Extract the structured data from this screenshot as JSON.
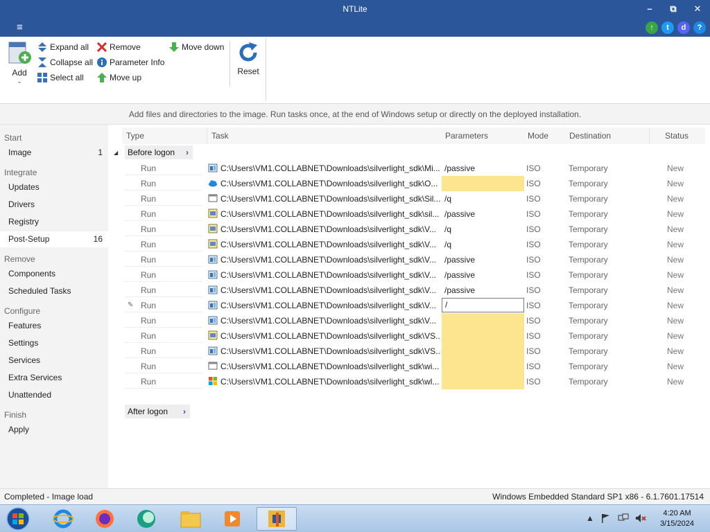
{
  "window": {
    "title": "NTLite",
    "minimize": "–",
    "restore": "⧉",
    "close": "✕"
  },
  "menu": {
    "hamburger": "≡"
  },
  "socials": [
    {
      "icon": "update-arrow-icon",
      "color": "#3aa545",
      "glyph": "↑"
    },
    {
      "icon": "twitter-icon",
      "color": "#2b579a",
      "glyph": "t"
    },
    {
      "icon": "discord-icon",
      "color": "#2b579a",
      "glyph": "d"
    },
    {
      "icon": "help-icon",
      "color": "#1e88e5",
      "glyph": "?"
    }
  ],
  "ribbon": {
    "add": "Add",
    "expand_all": "Expand all",
    "collapse_all": "Collapse all",
    "select_all": "Select all",
    "remove": "Remove",
    "parameter_info": "Parameter Info",
    "move_up": "Move up",
    "move_down": "Move down",
    "reset": "Reset"
  },
  "info": "Add files and directories to the image. Run tasks once, at the end of Windows setup or directly on the deployed installation.",
  "sidebar": {
    "start": "Start",
    "image": {
      "label": "Image",
      "count": "1"
    },
    "integrate": "Integrate",
    "updates": "Updates",
    "drivers": "Drivers",
    "registry": "Registry",
    "post_setup": {
      "label": "Post-Setup",
      "count": "16"
    },
    "remove": "Remove",
    "components": "Components",
    "scheduled_tasks": "Scheduled Tasks",
    "configure": "Configure",
    "features": "Features",
    "settings": "Settings",
    "services": "Services",
    "extra_services": "Extra Services",
    "unattended": "Unattended",
    "finish": "Finish",
    "apply": "Apply"
  },
  "columns": {
    "type": "Type",
    "task": "Task",
    "parameters": "Parameters",
    "mode": "Mode",
    "destination": "Destination",
    "status": "Status"
  },
  "groups": {
    "before_logon": "Before logon",
    "after_logon": "After logon"
  },
  "rows": [
    {
      "type": "Run",
      "task": "C:\\Users\\VM1.COLLABNET\\Downloads\\silverlight_sdk\\Mi...",
      "params": "/passive",
      "mode": "ISO",
      "dest": "Temporary",
      "status": "New",
      "icon": "installer"
    },
    {
      "type": "Run",
      "task": "C:\\Users\\VM1.COLLABNET\\Downloads\\silverlight_sdk\\O...",
      "params": "",
      "mode": "ISO",
      "dest": "Temporary",
      "status": "New",
      "icon": "cloud"
    },
    {
      "type": "Run",
      "task": "C:\\Users\\VM1.COLLABNET\\Downloads\\silverlight_sdk\\Sil...",
      "params": "/q",
      "mode": "ISO",
      "dest": "Temporary",
      "status": "New",
      "icon": "window"
    },
    {
      "type": "Run",
      "task": "C:\\Users\\VM1.COLLABNET\\Downloads\\silverlight_sdk\\sil...",
      "params": "/passive",
      "mode": "ISO",
      "dest": "Temporary",
      "status": "New",
      "icon": "setup"
    },
    {
      "type": "Run",
      "task": "C:\\Users\\VM1.COLLABNET\\Downloads\\silverlight_sdk\\V...",
      "params": "/q",
      "mode": "ISO",
      "dest": "Temporary",
      "status": "New",
      "icon": "setup"
    },
    {
      "type": "Run",
      "task": "C:\\Users\\VM1.COLLABNET\\Downloads\\silverlight_sdk\\V...",
      "params": "/q",
      "mode": "ISO",
      "dest": "Temporary",
      "status": "New",
      "icon": "setup"
    },
    {
      "type": "Run",
      "task": "C:\\Users\\VM1.COLLABNET\\Downloads\\silverlight_sdk\\V...",
      "params": "/passive",
      "mode": "ISO",
      "dest": "Temporary",
      "status": "New",
      "icon": "installer"
    },
    {
      "type": "Run",
      "task": "C:\\Users\\VM1.COLLABNET\\Downloads\\silverlight_sdk\\V...",
      "params": "/passive",
      "mode": "ISO",
      "dest": "Temporary",
      "status": "New",
      "icon": "installer"
    },
    {
      "type": "Run",
      "task": "C:\\Users\\VM1.COLLABNET\\Downloads\\silverlight_sdk\\V...",
      "params": "/passive",
      "mode": "ISO",
      "dest": "Temporary",
      "status": "New",
      "icon": "installer"
    },
    {
      "type": "Run",
      "task": "C:\\Users\\VM1.COLLABNET\\Downloads\\silverlight_sdk\\V...",
      "params": "/",
      "mode": "ISO",
      "dest": "Temporary",
      "status": "New",
      "icon": "installer",
      "editing": true
    },
    {
      "type": "Run",
      "task": "C:\\Users\\VM1.COLLABNET\\Downloads\\silverlight_sdk\\V...",
      "params": "",
      "mode": "ISO",
      "dest": "Temporary",
      "status": "New",
      "icon": "installer"
    },
    {
      "type": "Run",
      "task": "C:\\Users\\VM1.COLLABNET\\Downloads\\silverlight_sdk\\VS...",
      "params": "",
      "mode": "ISO",
      "dest": "Temporary",
      "status": "New",
      "icon": "setup"
    },
    {
      "type": "Run",
      "task": "C:\\Users\\VM1.COLLABNET\\Downloads\\silverlight_sdk\\VS...",
      "params": "",
      "mode": "ISO",
      "dest": "Temporary",
      "status": "New",
      "icon": "installer"
    },
    {
      "type": "Run",
      "task": "C:\\Users\\VM1.COLLABNET\\Downloads\\silverlight_sdk\\wi...",
      "params": "",
      "mode": "ISO",
      "dest": "Temporary",
      "status": "New",
      "icon": "window"
    },
    {
      "type": "Run",
      "task": "C:\\Users\\VM1.COLLABNET\\Downloads\\silverlight_sdk\\wl...",
      "params": "",
      "mode": "ISO",
      "dest": "Temporary",
      "status": "New",
      "icon": "windows"
    }
  ],
  "statusbar": {
    "left": "Completed - Image load",
    "right": "Windows Embedded Standard SP1 x86 - 6.1.7601.17514"
  },
  "clock": {
    "time": "4:20 AM",
    "date": "3/15/2024"
  },
  "taskbar": {
    "tray_expand": "▲",
    "apps": [
      {
        "name": "start-button",
        "icon": "windows-orb-icon"
      },
      {
        "name": "taskbar-internet-explorer",
        "icon": "internet-explorer-icon"
      },
      {
        "name": "taskbar-firefox",
        "icon": "firefox-icon"
      },
      {
        "name": "taskbar-app",
        "icon": "chat-bubble-icon"
      },
      {
        "name": "taskbar-explorer",
        "icon": "folder-icon"
      },
      {
        "name": "taskbar-media-player",
        "icon": "media-player-icon"
      },
      {
        "name": "taskbar-ntlite",
        "icon": "ntlite-icon"
      }
    ]
  }
}
